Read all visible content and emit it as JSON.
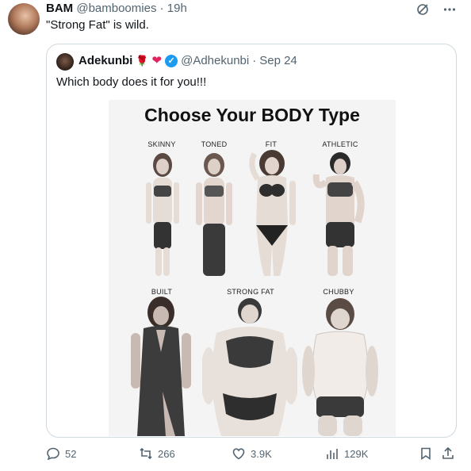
{
  "tweet": {
    "author_name": "BAM",
    "handle": "@bamboomies",
    "separator": "·",
    "time": "19h",
    "text": "\"Strong Fat\" is wild.",
    "more_icon": "more-horizontal-icon",
    "grok_icon": "grok-icon"
  },
  "quote": {
    "author_name": "Adekunbi",
    "emoji_rose": "🌹",
    "emoji_heart": "❤",
    "verified_icon": "verified-badge-icon",
    "handle": "@Adhekunbi",
    "separator": "·",
    "date": "Sep 24",
    "text": "Which body does it for you!!!",
    "image": {
      "title": "Choose Your BODY Type",
      "labels": [
        "SKINNY",
        "TONED",
        "FIT",
        "ATHLETIC",
        "BUILT",
        "STRONG FAT",
        "CHUBBY"
      ]
    }
  },
  "actions": {
    "replies": "52",
    "retweets": "266",
    "likes": "3.9K",
    "views": "129K"
  },
  "colors": {
    "text": "#0f1419",
    "muted": "#536471",
    "border": "#cfd9de",
    "verified": "#1d9bf0"
  }
}
